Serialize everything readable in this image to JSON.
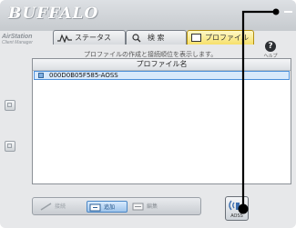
{
  "app": {
    "logo": "BUFFALO"
  },
  "brand": {
    "line1": "AirStation",
    "line2": "Client Manager"
  },
  "tabs": [
    {
      "label": "ステータス",
      "icon": "waveform-icon"
    },
    {
      "label": "検 索",
      "icon": "magnifier-icon"
    },
    {
      "label": "プロファイル",
      "icon": "profile-icon"
    }
  ],
  "description": "プロファイルの作成と接続順位を表示します。",
  "help": {
    "label": "ヘルプ"
  },
  "list": {
    "header": "プロファイル名",
    "items": [
      "000D0B05F585-AOSS"
    ]
  },
  "toolbar": {
    "connect_label": "接続",
    "add_label": "追加",
    "edit_label": "編集"
  },
  "aoss": {
    "label": "AOSS"
  },
  "colors": {
    "accent": "#f6e06a",
    "selection": "#d8e9fb",
    "callout": "#000000"
  }
}
